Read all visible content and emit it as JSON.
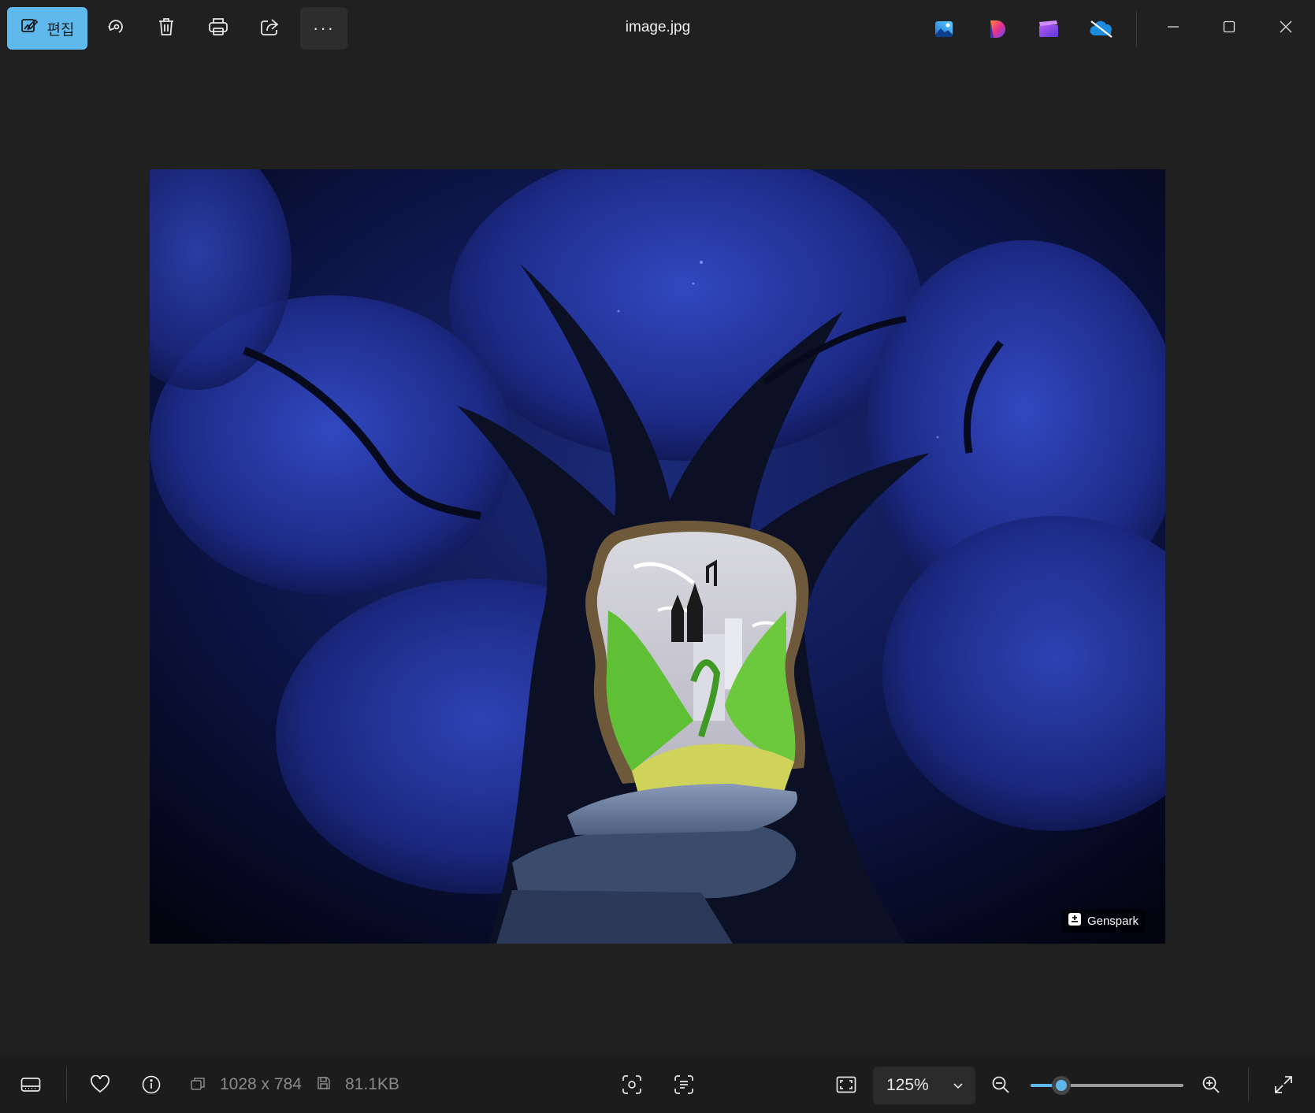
{
  "toolbar": {
    "edit_label": "편집",
    "rotate_icon": "rotate-icon",
    "delete_icon": "trash-icon",
    "print_icon": "printer-icon",
    "share_icon": "share-icon",
    "more_label": "···"
  },
  "window": {
    "title": "image.jpg",
    "apps": [
      "photos-app-icon",
      "designer-app-icon",
      "clipchamp-app-icon",
      "onedrive-icon"
    ]
  },
  "image": {
    "watermark": "Genspark"
  },
  "status": {
    "dimensions": "1028 x 784",
    "file_size": "81.1KB",
    "zoom_value": "125%",
    "zoom_slider_fraction": 0.2
  },
  "colors": {
    "accent": "#60b9ec",
    "background": "#202020",
    "statusbar": "#1c1c1c"
  }
}
